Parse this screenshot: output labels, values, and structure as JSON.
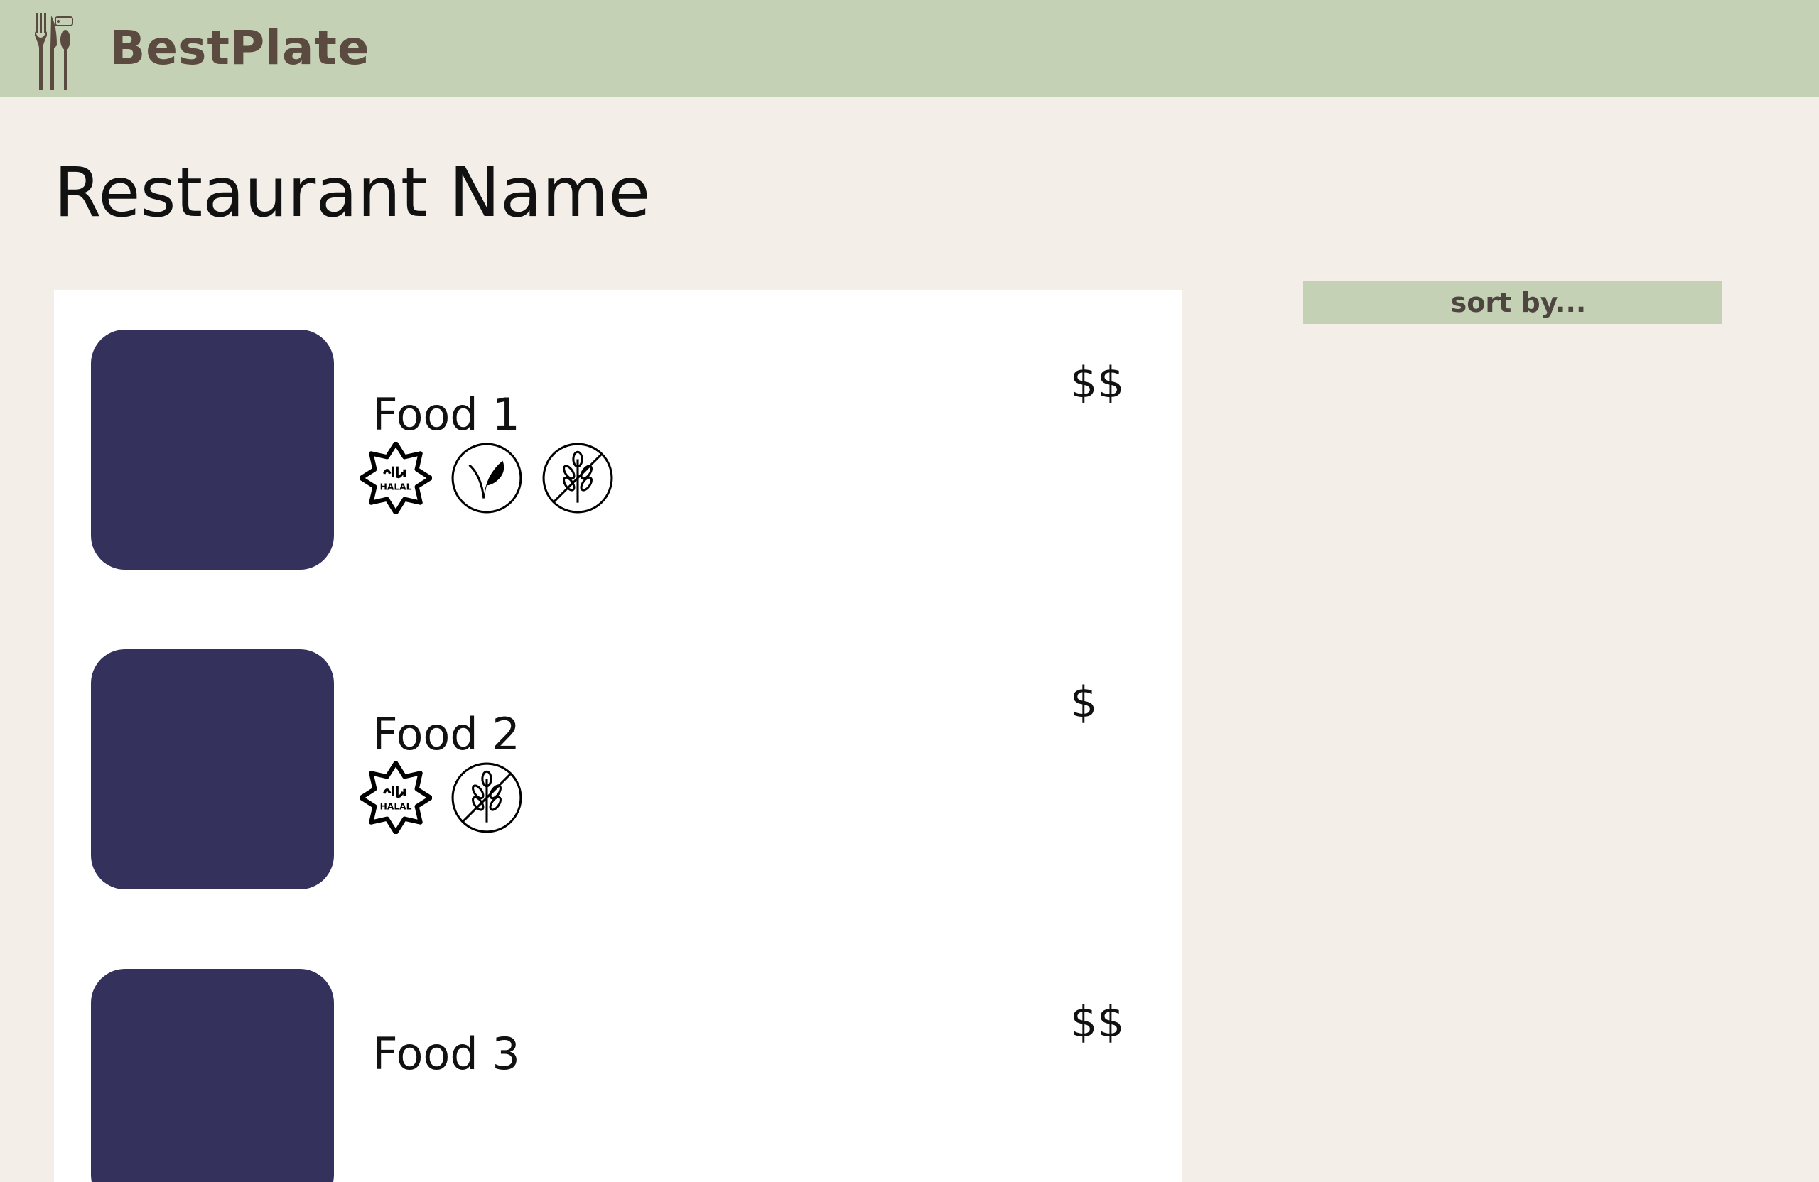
{
  "header": {
    "brand": "BestPlate",
    "logo_icon": "fork-knife-spoon-icon",
    "color": "#c4d1b5",
    "brand_color": "#5a4a40"
  },
  "page": {
    "title": "Restaurant Name",
    "background": "#f3efe8"
  },
  "sort": {
    "placeholder": "sort by..."
  },
  "menu": {
    "items": [
      {
        "name": "Food 1",
        "price": "$$",
        "image_color": "#34315d",
        "badges": [
          "halal-icon",
          "vegan-icon",
          "gluten-free-icon"
        ]
      },
      {
        "name": "Food 2",
        "price": "$",
        "image_color": "#34315d",
        "badges": [
          "halal-icon",
          "gluten-free-icon"
        ]
      },
      {
        "name": "Food 3",
        "price": "$$",
        "image_color": "#34315d",
        "badges": []
      }
    ]
  }
}
